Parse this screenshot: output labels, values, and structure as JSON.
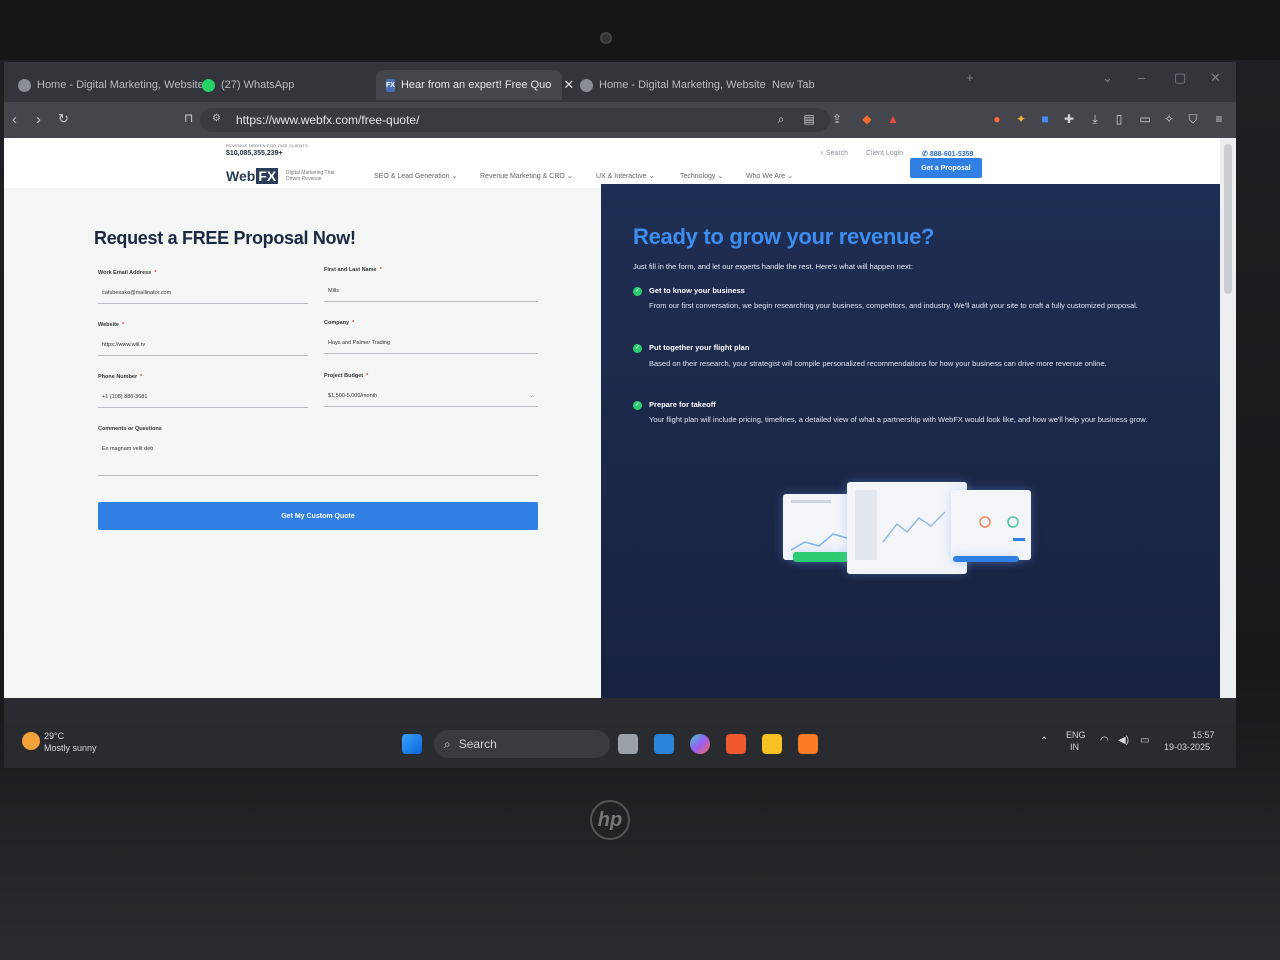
{
  "browser": {
    "tabs": [
      {
        "label": "Home - Digital Marketing, Website"
      },
      {
        "label": "(27) WhatsApp"
      },
      {
        "label": "Hear from an expert! Free Quo"
      },
      {
        "label": "Home - Digital Marketing, Website"
      },
      {
        "label": "New Tab"
      }
    ],
    "url": "https://www.webfx.com/free-quote/"
  },
  "site": {
    "revenue_label": "REVENUE DRIVEN FOR OUR CLIENTS",
    "revenue_value": "$10,085,355,239+",
    "logo_text": "Web",
    "logo_fx": "FX",
    "tagline": "Digital Marketing That Drives Revenue",
    "nav": [
      "SEO & Lead Generation",
      "Revenue Marketing & CRO",
      "UX & Interactive",
      "Technology",
      "Who We Are"
    ],
    "search_label": "Search",
    "client_login": "Client Login",
    "phone": "888-601-5359",
    "cta": "Get a Proposal"
  },
  "form": {
    "title": "Request a FREE Proposal Now!",
    "fields": {
      "email": {
        "label": "Work Email Address",
        "value": "cafubexako@mailinator.com"
      },
      "name": {
        "label": "First and Last Name",
        "value": "Mills"
      },
      "website": {
        "label": "Website",
        "value": "https://www.wili.tv"
      },
      "company": {
        "label": "Company",
        "value": "Hays and Palmer Trading"
      },
      "phone": {
        "label": "Phone Number",
        "value": "+1 (108) 886-3681"
      },
      "budget": {
        "label": "Project Budget",
        "value": "$1,500-5,000/month"
      },
      "comments": {
        "label": "Comments or Questions",
        "value": "Ex magnam velit deb"
      }
    },
    "submit": "Get My Custom Quote"
  },
  "panel": {
    "title": "Ready to grow your revenue?",
    "intro": "Just fill in the form, and let our experts handle the rest. Here's what will happen next:",
    "steps": [
      {
        "title": "Get to know your business",
        "body": "From our first conversation, we begin researching your business, competitors, and industry. We'll audit your site to craft a fully customized proposal."
      },
      {
        "title": "Put together your flight plan",
        "body": "Based on their research, your strategist will compile personalized recommendations for how your business can drive more revenue online."
      },
      {
        "title": "Prepare for takeoff",
        "body": "Your flight plan will include pricing, timelines, a detailed view of what a partnership with WebFX would look like, and how we'll help your business grow."
      }
    ]
  },
  "taskbar": {
    "weather_temp": "29°C",
    "weather_desc": "Mostly sunny",
    "search": "Search",
    "lang": "ENG",
    "region": "IN",
    "time": "15:57",
    "date": "19-03-2025"
  },
  "colors": {
    "accent": "#2f7fe5",
    "panel_bg": "#1f2e54",
    "panel_title": "#3d8ef0",
    "check": "#2ecc71"
  }
}
